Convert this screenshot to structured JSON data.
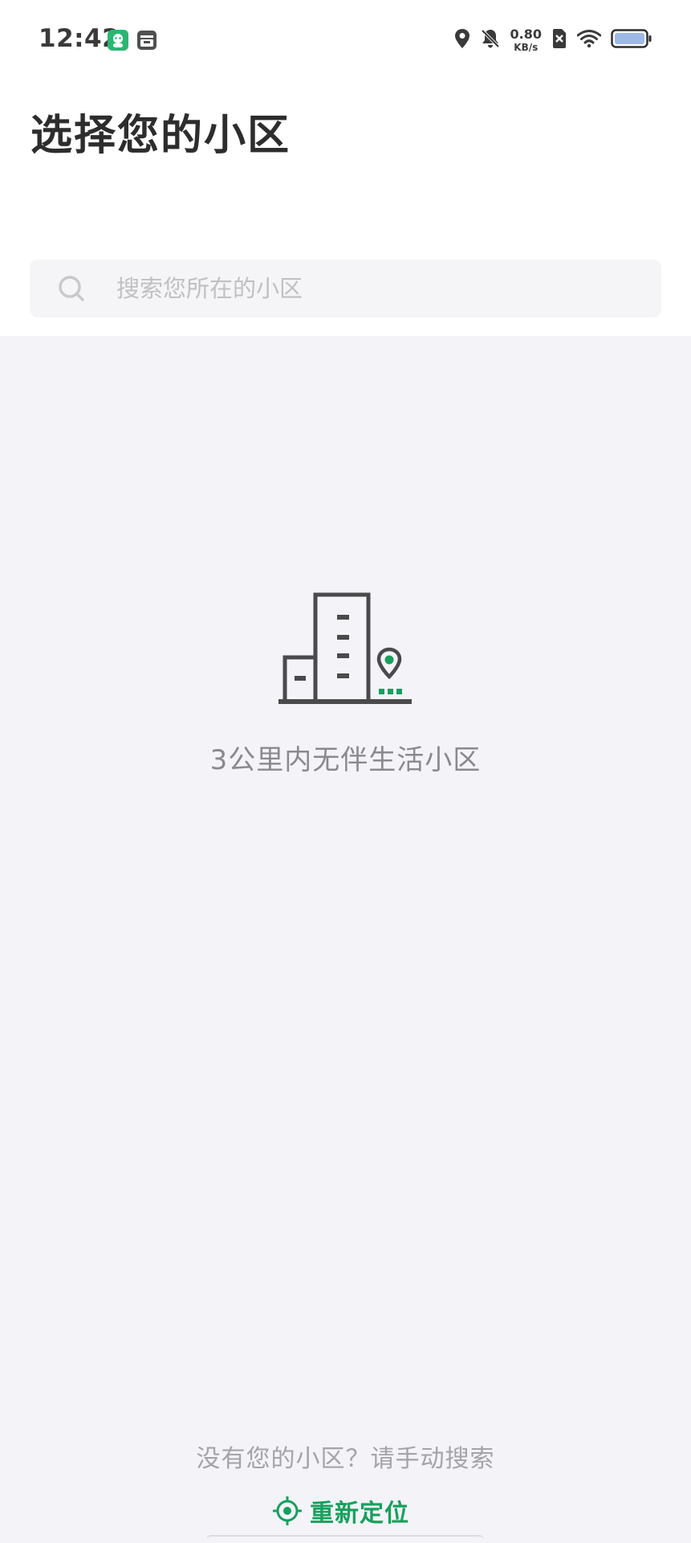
{
  "status_bar": {
    "time": "12:42",
    "net_speed_value": "0.80",
    "net_speed_unit": "KB/s",
    "icons": [
      "app-notification-icon",
      "calendar-icon",
      "location-icon",
      "mute-bell-icon",
      "sim-off-icon",
      "wifi-icon",
      "battery-icon"
    ],
    "accent_green": "#2bb673"
  },
  "header": {
    "title": "选择您的小区"
  },
  "search": {
    "placeholder": "搜索您所在的小区",
    "value": ""
  },
  "empty_state": {
    "icon": "building-location-icon",
    "message": "3公里内无伴生活小区"
  },
  "footer": {
    "hint": "没有您的小区？请手动搜索",
    "relocate_label": "重新定位",
    "relocate_icon": "locate-target-icon",
    "accent_color": "#17a05d"
  }
}
